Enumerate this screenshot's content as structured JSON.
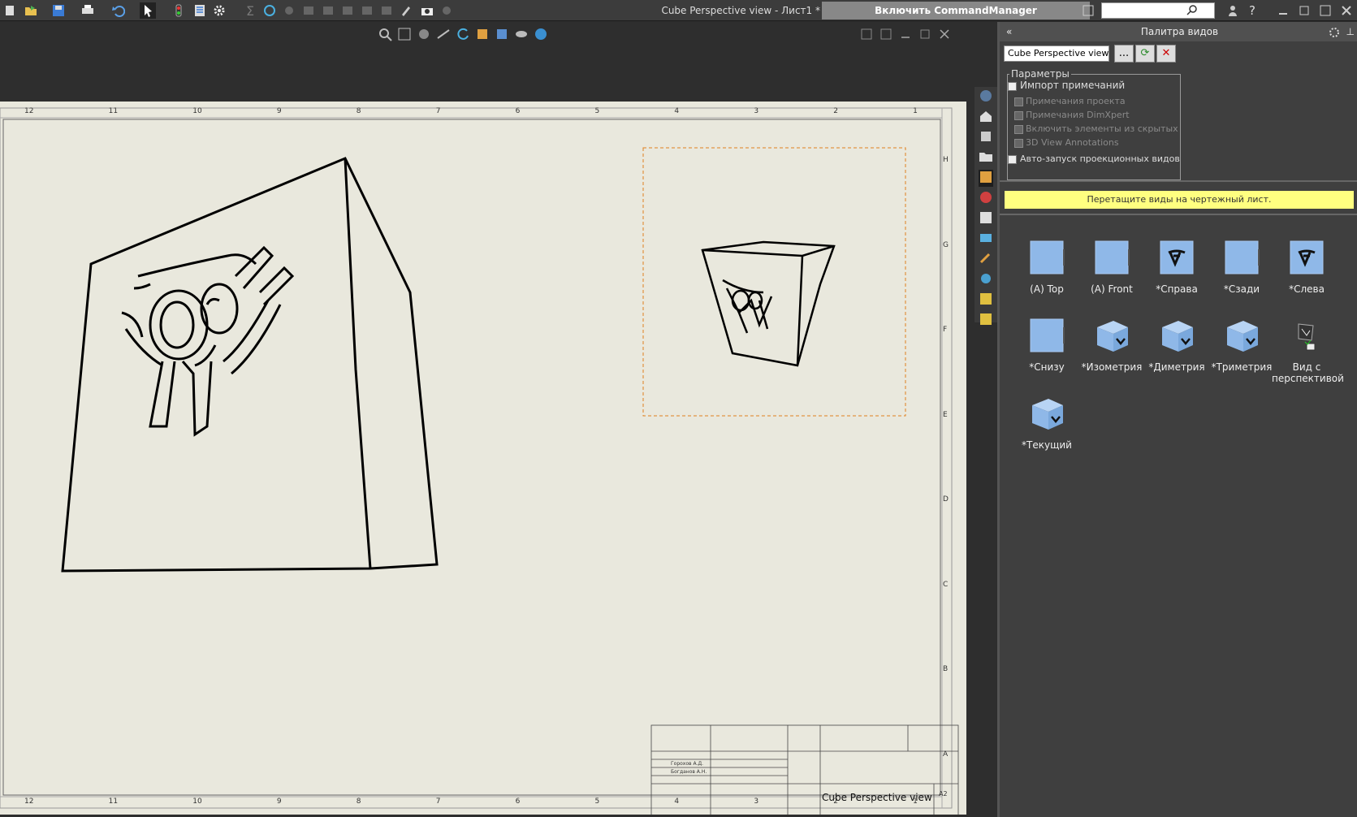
{
  "toolbar": {
    "window_title": "Cube Perspective view - Лист1 *",
    "command_manager": "Включить CommandManager",
    "search_placeholder": ""
  },
  "panel": {
    "title": "Палитра видов",
    "selected_model": "Cube Perspective view",
    "browse_label": "...",
    "params_title": "Параметры",
    "import_annotations": "Импорт примечаний",
    "design_annotations": "Примечания проекта",
    "dimxpert_annotations": "Примечания DimXpert",
    "include_hidden": "Включить элементы из скрытых",
    "annotations_3d": "3D View Annotations",
    "auto_projected": "Авто-запуск проекционных видов",
    "hint": "Перетащите виды на чертежный лист.",
    "views": [
      {
        "label": "(A) Top",
        "icon": "flat"
      },
      {
        "label": "(A) Front",
        "icon": "flat"
      },
      {
        "label": "*Справа",
        "icon": "logo"
      },
      {
        "label": "*Сзади",
        "icon": "flat"
      },
      {
        "label": "*Слева",
        "icon": "logo"
      },
      {
        "label": "*Снизу",
        "icon": "flat"
      },
      {
        "label": "*Изометрия",
        "icon": "cube"
      },
      {
        "label": "*Диметрия",
        "icon": "cube"
      },
      {
        "label": "*Триметрия",
        "icon": "cube"
      },
      {
        "label": "Вид с перспективой",
        "icon": "persp"
      },
      {
        "label": "*Текущий",
        "icon": "cube"
      }
    ]
  },
  "sheet": {
    "top_numbers": [
      "12",
      "11",
      "10",
      "9",
      "8",
      "7",
      "6",
      "5",
      "4",
      "3",
      "2",
      "1"
    ],
    "side_letters": [
      "H",
      "G",
      "F",
      "E",
      "D",
      "C",
      "B",
      "A"
    ],
    "title_block_name": "Cube Perspective view",
    "sheet_size": "A2",
    "developer": "Горохов А.Д.",
    "checker": "Богданов А.Н."
  }
}
